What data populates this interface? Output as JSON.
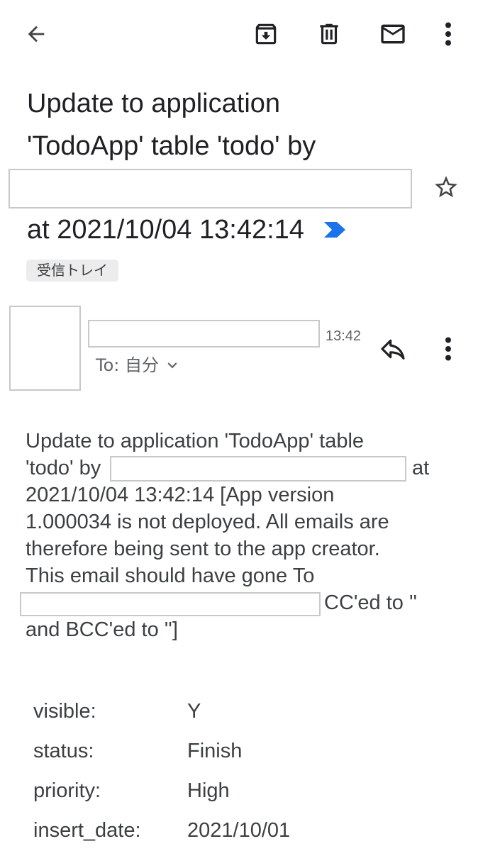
{
  "toolbar": {
    "back": "arrow-back-icon",
    "archive": "archive-icon",
    "delete": "trash-icon",
    "mark_unread": "mail-icon",
    "more": "more-vert-icon"
  },
  "subject": {
    "line1": "Update to application",
    "line2": "'TodoApp' table 'todo' by",
    "line3": "at 2021/10/04 13:42:14"
  },
  "label_chip": "受信トレイ",
  "message": {
    "time": "13:42",
    "to_label": "To: 自分",
    "body_lines": [
      "Update to application 'TodoApp' table",
      "'todo' by",
      "at",
      "2021/10/04 13:42:14 [App version",
      "1.000034 is not deployed. All emails are",
      "therefore being sent to the app creator.",
      "This email should have gone To",
      "CC'ed to ''",
      "and BCC'ed to '']"
    ]
  },
  "fields": [
    {
      "key": "visible:",
      "value": "Y"
    },
    {
      "key": "status:",
      "value": "Finish"
    },
    {
      "key": "priority:",
      "value": "High"
    },
    {
      "key": "insert_date:",
      "value": "2021/10/01"
    }
  ],
  "colors": {
    "importance_marker": "#1a73e8",
    "text": "#202124",
    "body_text": "#3c4043",
    "redaction_border": "#c8c8c8",
    "chip_bg": "#ececec"
  }
}
